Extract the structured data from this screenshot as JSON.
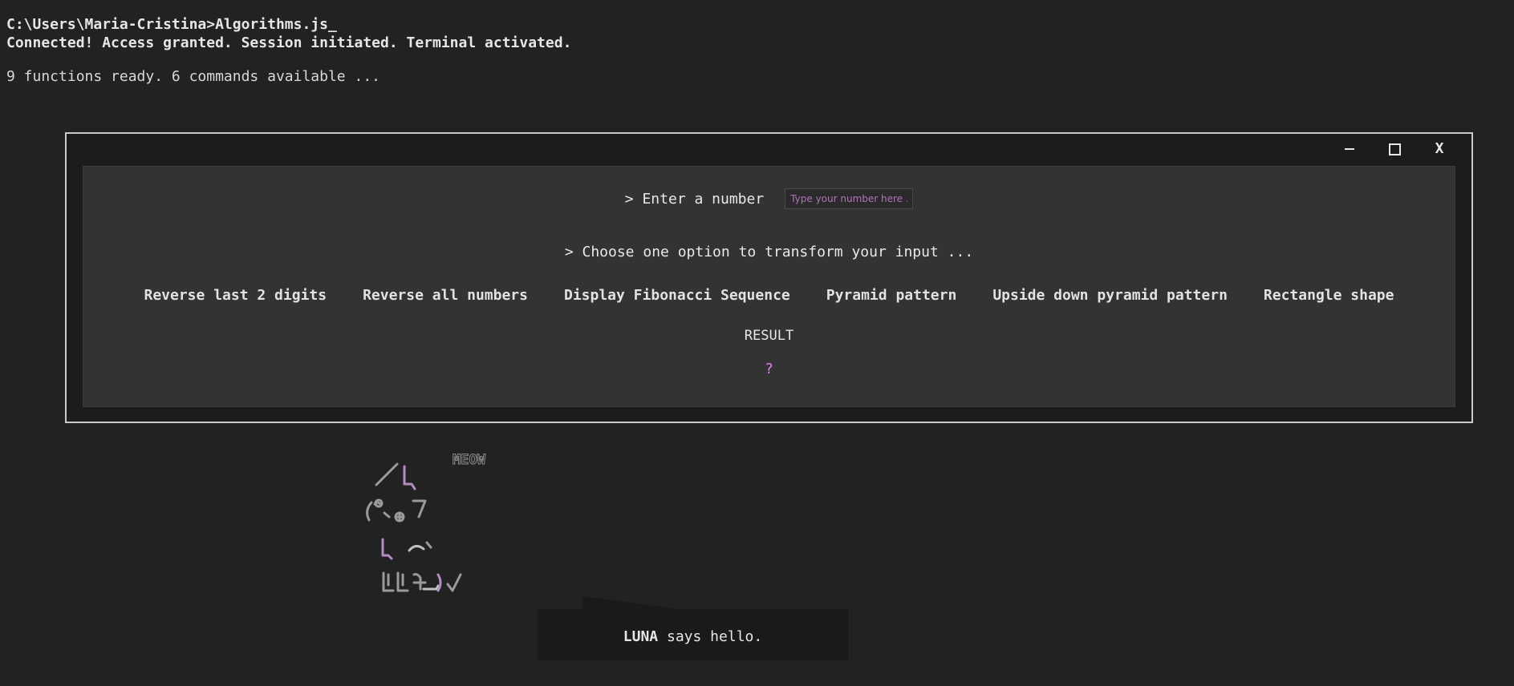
{
  "terminal": {
    "path_line": "C:\\Users\\Maria-Cristina>Algorithms.js_",
    "status_line": "Connected! Access granted. Session initiated. Terminal activated.",
    "info_line": "9 functions ready. 6 commands available ..."
  },
  "window": {
    "minimize_icon": "minimize-icon",
    "maximize_icon": "maximize-icon",
    "close_label": "X"
  },
  "form": {
    "number_prompt": "> Enter a number",
    "number_placeholder": "Type your number here ...",
    "number_value": "",
    "choose_prompt": "> Choose one option to transform your input ...",
    "options": [
      "Reverse last 2 digits",
      "Reverse all numbers",
      "Display Fibonacci Sequence",
      "Pyramid pattern",
      "Upside down pyramid pattern",
      "Rectangle shape"
    ],
    "result_label": "RESULT",
    "result_value": "?"
  },
  "mascot": {
    "meow_text": "MEOW",
    "speech_name": "LUNA",
    "speech_rest": " says hello."
  },
  "colors": {
    "background": "#222222",
    "panel": "#333333",
    "accent_pink": "#d78be0"
  }
}
